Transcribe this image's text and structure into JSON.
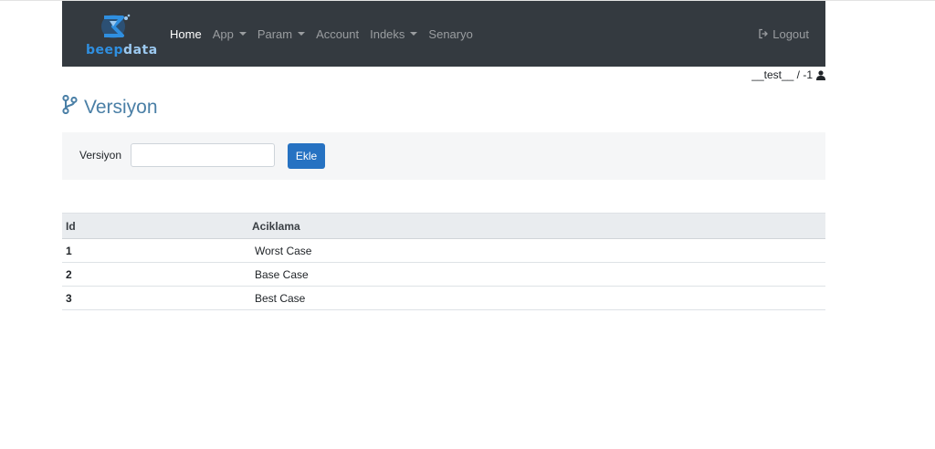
{
  "brand": {
    "part1": "beep",
    "part2": "data",
    "colors": {
      "primary": "#2f8fe0",
      "secondary": "#9cc9f0"
    }
  },
  "nav": {
    "items": [
      {
        "label": "Home",
        "active": true,
        "dropdown": false
      },
      {
        "label": "App",
        "active": false,
        "dropdown": true
      },
      {
        "label": "Param",
        "active": false,
        "dropdown": true
      },
      {
        "label": "Account",
        "active": false,
        "dropdown": false
      },
      {
        "label": "Indeks",
        "active": false,
        "dropdown": true
      },
      {
        "label": "Senaryo",
        "active": false,
        "dropdown": false
      }
    ],
    "logout_label": "Logout",
    "logout_icon": "sign-out-icon"
  },
  "user": {
    "text": "__test__ / -1",
    "icon": "user-icon"
  },
  "page": {
    "title": "Versiyon",
    "title_icon": "code-branch-icon"
  },
  "form": {
    "label": "Versiyon",
    "input_value": "",
    "button_label": "Ekle"
  },
  "table": {
    "headers": {
      "id": "Id",
      "desc": "Aciklama"
    },
    "rows": [
      {
        "id": "1",
        "desc": "Worst Case"
      },
      {
        "id": "2",
        "desc": "Base Case"
      },
      {
        "id": "3",
        "desc": "Best Case"
      }
    ]
  },
  "colors": {
    "navbar_bg": "#343a40",
    "title": "#4a7fa6",
    "button": "#2672c2"
  }
}
